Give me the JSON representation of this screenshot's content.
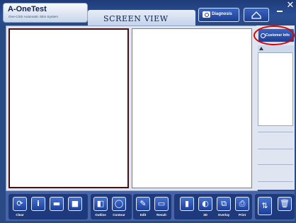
{
  "app": {
    "title": "A-OneTest",
    "subtitle": "One-Click Automatic Skin System",
    "screen_title": "SCREEN VIEW"
  },
  "header": {
    "diagnosis_label": "Diagnosis",
    "close_glyph": "✕",
    "home_icon": "home-icon",
    "minimize_icon": "minimize-icon"
  },
  "right_panel": {
    "customer_label": "Customer Info",
    "highlight_color": "#d00000"
  },
  "toolbar": {
    "clear": "Clear",
    "outline": "Outline",
    "contour": "Contour",
    "edit": "Edit",
    "result": "Result",
    "three_d": "3D",
    "overlay": "Overlay",
    "print": "Print"
  },
  "colors": {
    "accent": "#1e3e91",
    "frame": "#2a4a86"
  }
}
